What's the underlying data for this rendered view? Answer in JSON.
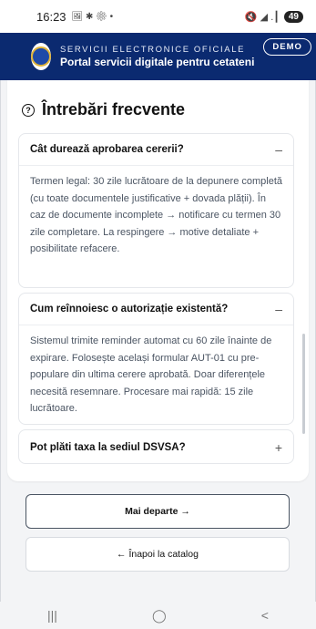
{
  "status_bar": {
    "time": "16:23",
    "left_icons": "🖼 ✱ ⚙ •",
    "right_icons": "🔇 ◢ .┃",
    "battery": "49"
  },
  "header": {
    "kicker": "SERVICII ELECTRONICE OFICIALE",
    "title": "Portal servicii digitale pentru cetateni",
    "badge": "DEMO"
  },
  "faq": {
    "title": "Întrebări frecvente",
    "items": [
      {
        "question": "Cât durează aprobarea cererii?",
        "toggle": "–",
        "expanded": true,
        "answer": "Termen legal: 30 zile lucrătoare de la depunere completă (cu toate documentele justificative + dovada plății). În caz de documente incomplete → notificare cu termen 30 zile completare. La respingere → motive detaliate + posibilitate refacere."
      },
      {
        "question": "Cum reînnoiesc o autorizație existentă?",
        "toggle": "–",
        "expanded": true,
        "answer": "Sistemul trimite reminder automat cu 60 zile înainte de expirare. Folosește același formular AUT-01 cu pre-populare din ultima cerere aprobată. Doar diferențele necesită resemnare. Procesare mai rapidă: 15 zile lucrătoare."
      },
      {
        "question": "Pot plăti taxa la sediul DSVSA?",
        "toggle": "+",
        "expanded": false,
        "answer": ""
      }
    ]
  },
  "actions": {
    "next": "Mai departe →",
    "back": "← Înapoi la catalog"
  },
  "navbar": {
    "recent": "|||",
    "home": "◯",
    "back": "<"
  }
}
